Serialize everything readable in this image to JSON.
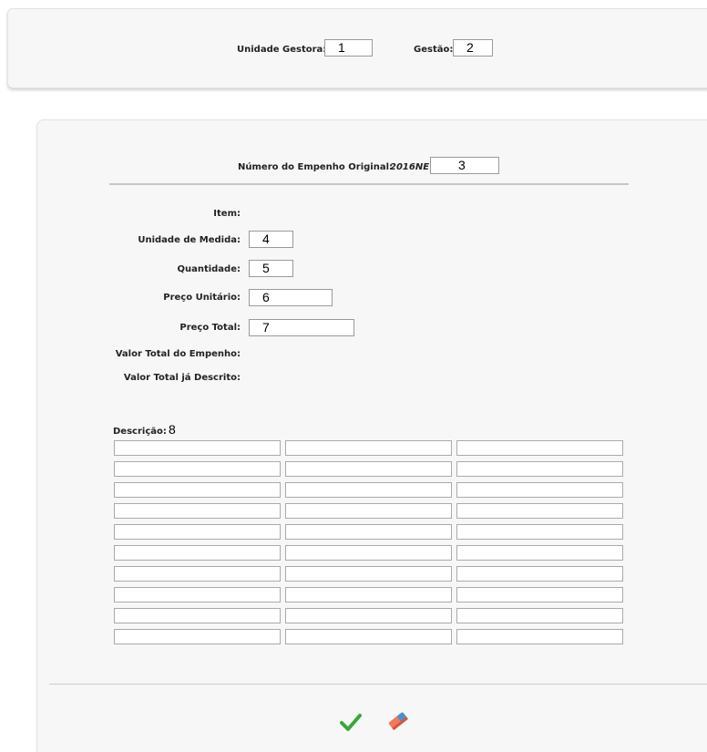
{
  "header": {
    "unidade_gestora_label": "Unidade Gestora:",
    "unidade_gestora_value": "1",
    "gestao_label": "Gestão:",
    "gestao_value": "2"
  },
  "empenho": {
    "label": "Número do Empenho Original:",
    "prefix": "2016NE",
    "value": "3"
  },
  "fields": {
    "item_label": "Item:",
    "unidade_medida_label": "Unidade de Medida:",
    "unidade_medida_value": "4",
    "quantidade_label": "Quantidade:",
    "quantidade_value": "5",
    "preco_unitario_label": "Preço Unitário:",
    "preco_unitario_value": "6",
    "preco_total_label": "Preço Total:",
    "preco_total_value": "7",
    "valor_total_empenho_label": "Valor Total do Empenho:",
    "valor_total_descrito_label": "Valor Total já Descrito:"
  },
  "descricao": {
    "label": "Descrição:",
    "marker": "8",
    "rows": 10,
    "columns": 3
  },
  "actions": {
    "confirm_icon": "check-icon",
    "clear_icon": "eraser-icon",
    "confirm_color": "#3aa63a",
    "clear_color": "#f07a5a"
  }
}
